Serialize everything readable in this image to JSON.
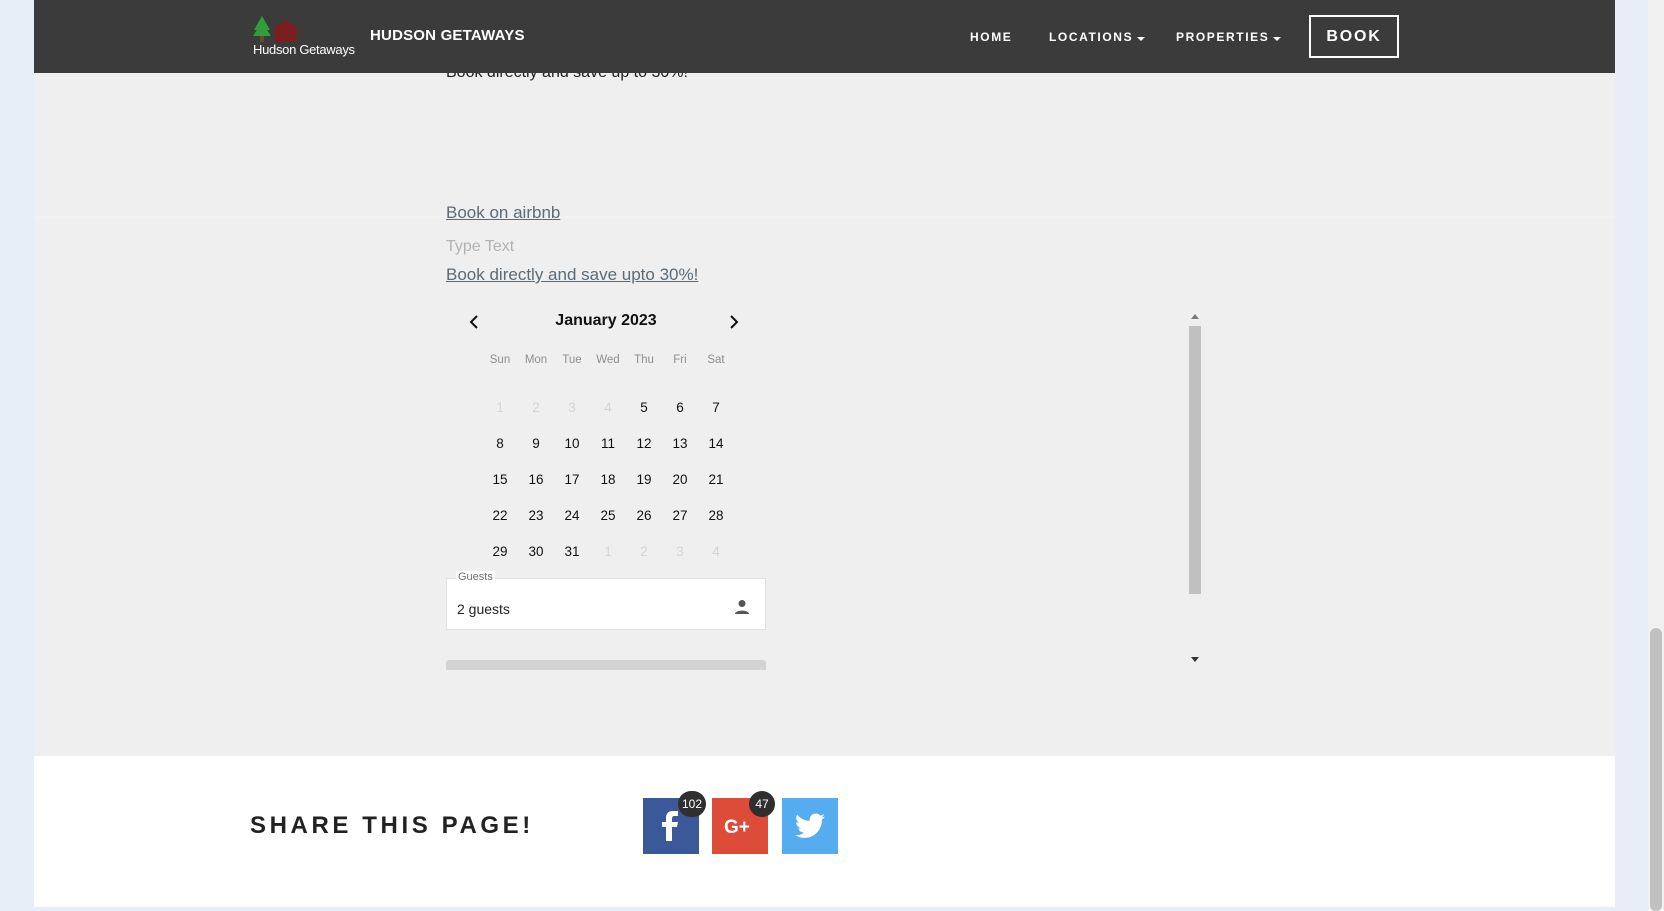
{
  "header": {
    "logo_text": "Hudson Getaways",
    "brand": "HUDSON GETAWAYS",
    "nav": [
      {
        "label": "HOME"
      },
      {
        "label": "LOCATIONS"
      },
      {
        "label": "PROPERTIES"
      }
    ],
    "book_label": "BOOK"
  },
  "content": {
    "intro_text": "Book directly and save up to 30%!",
    "airbnb_link": "Book on airbnb",
    "type_text_placeholder": "Type Text",
    "direct_link": "Book directly and save upto 30%!"
  },
  "calendar": {
    "month_label": "January 2023",
    "weekdays": [
      "Sun",
      "Mon",
      "Tue",
      "Wed",
      "Thu",
      "Fri",
      "Sat"
    ],
    "weeks": [
      [
        "1",
        "2",
        "3",
        "4",
        "5",
        "6",
        "7"
      ],
      [
        "8",
        "9",
        "10",
        "11",
        "12",
        "13",
        "14"
      ],
      [
        "15",
        "16",
        "17",
        "18",
        "19",
        "20",
        "21"
      ],
      [
        "22",
        "23",
        "24",
        "25",
        "26",
        "27",
        "28"
      ],
      [
        "29",
        "30",
        "31",
        "1",
        "2",
        "3",
        "4"
      ]
    ]
  },
  "guests": {
    "label": "Guests",
    "value": "2 guests"
  },
  "share": {
    "title": "SHARE THIS PAGE!",
    "facebook_count": "102",
    "googleplus_count": "47",
    "icons": [
      "facebook-icon",
      "google-plus-icon",
      "twitter-icon"
    ]
  },
  "colors": {
    "header_bg": "#3a3b3a",
    "page_bg": "#efefef",
    "facebook": "#3b5998",
    "googleplus": "#dd4b39",
    "twitter": "#55acee"
  }
}
